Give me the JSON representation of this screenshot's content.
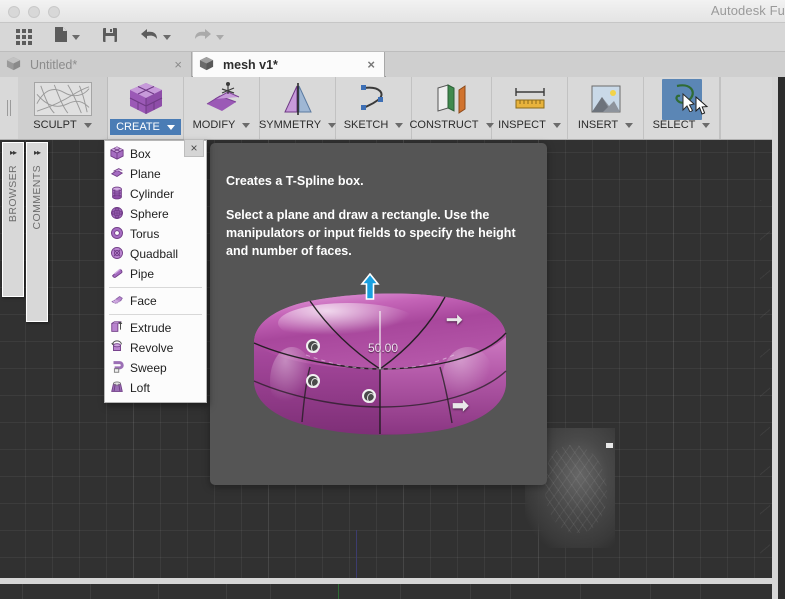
{
  "window": {
    "app_title": "Autodesk Fu",
    "traffic_lights": [
      "close",
      "minimize",
      "zoom"
    ]
  },
  "quick_access": {
    "items": [
      {
        "name": "apps-grid",
        "icon": "grid-icon",
        "label": "",
        "has_caret": false
      },
      {
        "name": "new-file",
        "icon": "file-icon",
        "label": "",
        "has_caret": true
      },
      {
        "name": "save",
        "icon": "floppy-disk-icon",
        "label": "",
        "has_caret": false
      },
      {
        "name": "undo",
        "icon": "undo-arrow-icon",
        "label": "",
        "has_caret": true
      },
      {
        "name": "redo",
        "icon": "redo-arrow-icon",
        "label": "",
        "has_caret": true,
        "disabled": true
      }
    ]
  },
  "tabs": [
    {
      "label": "Untitled*",
      "active": false,
      "close": "×"
    },
    {
      "label": "mesh v1*",
      "active": true,
      "close": "×"
    }
  ],
  "ribbon": {
    "workspace": {
      "label": "SCULPT",
      "icon": "mesh-wireframe-icon",
      "caret": "▾"
    },
    "panels": [
      {
        "label": "CREATE",
        "icon": "purple-box-icon",
        "active": true,
        "caret": "▾"
      },
      {
        "label": "MODIFY",
        "icon": "modify-surface-icon",
        "active": false,
        "caret": "▾"
      },
      {
        "label": "SYMMETRY",
        "icon": "mirror-plane-icon",
        "active": false,
        "caret": "▾"
      },
      {
        "label": "SKETCH",
        "icon": "spline-curve-icon",
        "active": false,
        "caret": "▾"
      },
      {
        "label": "CONSTRUCT",
        "icon": "planes-icon",
        "active": false,
        "caret": "▾"
      },
      {
        "label": "INSPECT",
        "icon": "ruler-icon",
        "active": false,
        "caret": "▾"
      },
      {
        "label": "INSERT",
        "icon": "image-mountain-icon",
        "active": false,
        "caret": "▾"
      },
      {
        "label": "SELECT",
        "icon": "lasso-select-icon",
        "active": false,
        "selected": true,
        "caret": "▾"
      }
    ]
  },
  "dock_panels": [
    {
      "label": "BROWSER",
      "expander": "▸▸"
    },
    {
      "label": "COMMENTS",
      "expander": "▸▸"
    }
  ],
  "create_menu": {
    "close_label": "×",
    "groups": [
      {
        "items": [
          {
            "label": "Box",
            "icon": "box-icon"
          },
          {
            "label": "Plane",
            "icon": "plane-icon"
          },
          {
            "label": "Cylinder",
            "icon": "cylinder-icon"
          },
          {
            "label": "Sphere",
            "icon": "sphere-icon"
          },
          {
            "label": "Torus",
            "icon": "torus-icon"
          },
          {
            "label": "Quadball",
            "icon": "quadball-icon"
          },
          {
            "label": "Pipe",
            "icon": "pipe-icon"
          }
        ]
      },
      {
        "items": [
          {
            "label": "Face",
            "icon": "face-icon"
          }
        ]
      },
      {
        "items": [
          {
            "label": "Extrude",
            "icon": "extrude-icon"
          },
          {
            "label": "Revolve",
            "icon": "revolve-icon"
          },
          {
            "label": "Sweep",
            "icon": "sweep-icon"
          },
          {
            "label": "Loft",
            "icon": "loft-icon"
          }
        ]
      }
    ]
  },
  "tooltip": {
    "title": "Creates a T-Spline box.",
    "body": "Select a plane and draw a rectangle. Use the manipulators or input fields to specify the height and number of faces.",
    "illustration": {
      "name": "t-spline-box-preview",
      "dimension_label": "50.00",
      "manipulators": [
        "height-arrow-up",
        "face-count-handle",
        "edge-arrow-right",
        "edge-arrow-down"
      ]
    }
  },
  "canvas": {
    "name": "viewport-3d",
    "background_color": "#313131",
    "grid_color": "#3f3f3f",
    "object": "imported-mesh"
  },
  "colors": {
    "accent_blue": "#4a7cb5",
    "select_highlight": "#5b86b5",
    "ribbon_bg": "#d9d9d9",
    "tooltip_bg": "#555555",
    "menu_purple": "#9b59b6",
    "box_magenta": "#b05fb0"
  }
}
